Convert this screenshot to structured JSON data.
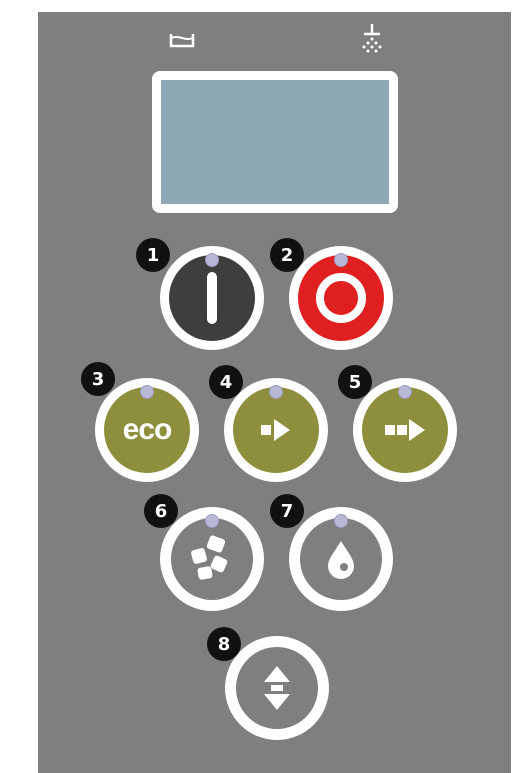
{
  "panel": {
    "top_icons": [
      "basin-icon",
      "shower-icon"
    ]
  },
  "buttons": [
    {
      "number": "1",
      "icon": "power-on-icon",
      "color": "#3e3e3c"
    },
    {
      "number": "2",
      "icon": "power-off-icon",
      "color": "#e02020"
    },
    {
      "number": "3",
      "icon": "eco-icon",
      "label": "eco",
      "color": "#8e8f3c"
    },
    {
      "number": "4",
      "icon": "play-short-icon",
      "color": "#8e8f3c"
    },
    {
      "number": "5",
      "icon": "play-long-icon",
      "color": "#8e8f3c"
    },
    {
      "number": "6",
      "icon": "dishes-icon",
      "color": "#7f7f80"
    },
    {
      "number": "7",
      "icon": "drop-icon",
      "color": "#7f7f80"
    },
    {
      "number": "8",
      "icon": "up-down-icon",
      "color": "#7f7f80"
    }
  ]
}
